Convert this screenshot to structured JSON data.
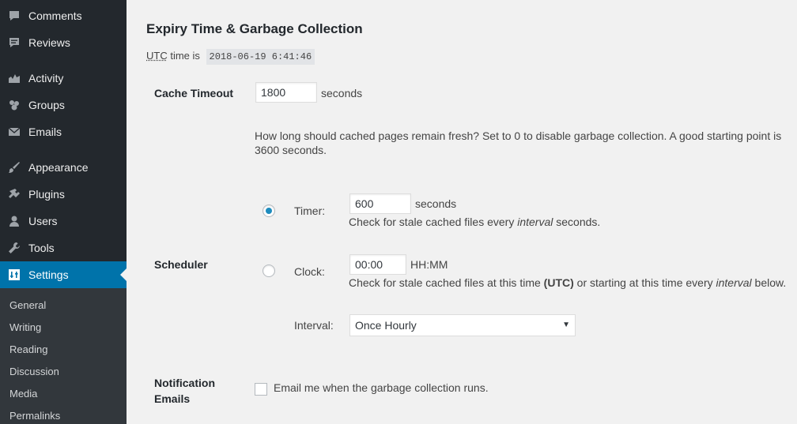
{
  "sidebar": {
    "items": [
      {
        "label": "Comments",
        "icon": "comment-icon"
      },
      {
        "label": "Reviews",
        "icon": "reviews-icon"
      },
      {
        "label": "Activity",
        "icon": "activity-icon"
      },
      {
        "label": "Groups",
        "icon": "groups-icon"
      },
      {
        "label": "Emails",
        "icon": "email-icon"
      },
      {
        "label": "Appearance",
        "icon": "paintbrush-icon"
      },
      {
        "label": "Plugins",
        "icon": "plugin-icon"
      },
      {
        "label": "Users",
        "icon": "user-icon"
      },
      {
        "label": "Tools",
        "icon": "wrench-icon"
      },
      {
        "label": "Settings",
        "icon": "settings-icon",
        "active": true
      }
    ],
    "submenu": [
      "General",
      "Writing",
      "Reading",
      "Discussion",
      "Media",
      "Permalinks"
    ]
  },
  "main": {
    "section_title": "Expiry Time & Garbage Collection",
    "utc_abbr": "UTC",
    "utc_text": "time is",
    "utc_time": "2018-06-19 6:41:46",
    "cache_timeout": {
      "label": "Cache Timeout",
      "value": "1800",
      "unit": "seconds",
      "description": "How long should cached pages remain fresh? Set to 0 to disable garbage collection. A good starting point is 3600 seconds."
    },
    "scheduler": {
      "label": "Scheduler",
      "timer": {
        "label": "Timer:",
        "selected": true,
        "value": "600",
        "unit": "seconds",
        "desc_pre": "Check for stale cached files every",
        "desc_em": "interval",
        "desc_post": "seconds."
      },
      "clock": {
        "label": "Clock:",
        "selected": false,
        "value": "00:00",
        "unit": "HH:MM",
        "desc_pre": "Check for stale cached files at this time",
        "desc_bold": "(UTC)",
        "desc_mid": "or starting at this time every",
        "desc_em": "interval",
        "desc_post": "below."
      },
      "interval": {
        "label": "Interval:",
        "value": "Once Hourly"
      }
    },
    "notification": {
      "label_line1": "Notification",
      "label_line2": "Emails",
      "checkbox_label": "Email me when the garbage collection runs.",
      "checked": false
    }
  },
  "colors": {
    "sidebar_bg": "#23282d",
    "submenu_bg": "#32373c",
    "accent": "#0073aa",
    "page_bg": "#f1f1f1"
  }
}
